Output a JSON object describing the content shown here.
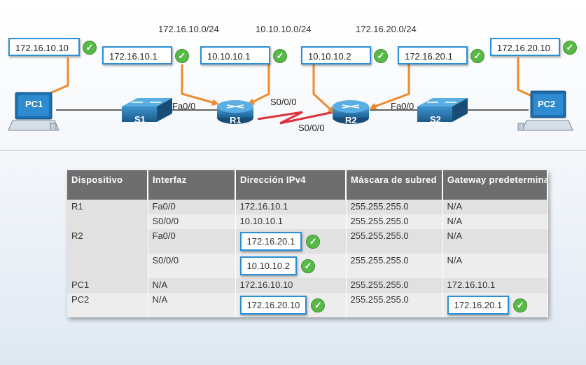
{
  "subnets": [
    "172.16.10.0/24",
    "10.10.10.0/24",
    "172.16.20.0/24"
  ],
  "boxes": {
    "pc1": "172.16.10.10",
    "r1_fa00": "172.16.10.1",
    "r1_s000": "10.10.10.1",
    "r2_s000": "10.10.10.2",
    "r2_fa00": "172.16.20.1",
    "pc2": "172.16.20.10"
  },
  "check_glyph": "✓",
  "devices": {
    "pc1": "PC1",
    "s1": "S1",
    "r1": "R1",
    "r2": "R2",
    "s2": "S2",
    "pc2": "PC2"
  },
  "port_labels": {
    "r1_fa": "Fa0/0",
    "r1_s": "S0/0/0",
    "r2_s": "S0/0/0",
    "r2_fa": "Fa0/0"
  },
  "colors": {
    "arrow": "#f08a2c",
    "box_border": "#2a8fd6",
    "check": "#58b947",
    "router": "#1e78b4",
    "serial": "#e0303a",
    "header_bg": "#6e6e6e"
  },
  "table": {
    "headers": [
      "Dispositivo",
      "Interfaz",
      "Dirección IPv4",
      "Máscara de subred",
      "Gateway predeterminado"
    ],
    "rows": [
      {
        "device": "R1",
        "iface": "Fa0/0",
        "ip": "172.16.10.1",
        "mask": "255.255.255.0",
        "gw": "N/A"
      },
      {
        "device": "",
        "iface": "S0/0/0",
        "ip": "10.10.10.1",
        "mask": "255.255.255.0",
        "gw": "N/A"
      },
      {
        "device": "R2",
        "iface": "Fa0/0",
        "ip": "172.16.20.1",
        "mask": "255.255.255.0",
        "gw": "N/A"
      },
      {
        "device": "",
        "iface": "S0/0/0",
        "ip": "10.10.10.2",
        "mask": "255.255.255.0",
        "gw": "N/A"
      },
      {
        "device": "PC1",
        "iface": "N/A",
        "ip": "172.16.10.10",
        "mask": "255.255.255.0",
        "gw": "172.16.10.1"
      },
      {
        "device": "PC2",
        "iface": "N/A",
        "ip": "172.16.20.10",
        "mask": "255.255.255.0",
        "gw": "172.16.20.1"
      }
    ]
  }
}
